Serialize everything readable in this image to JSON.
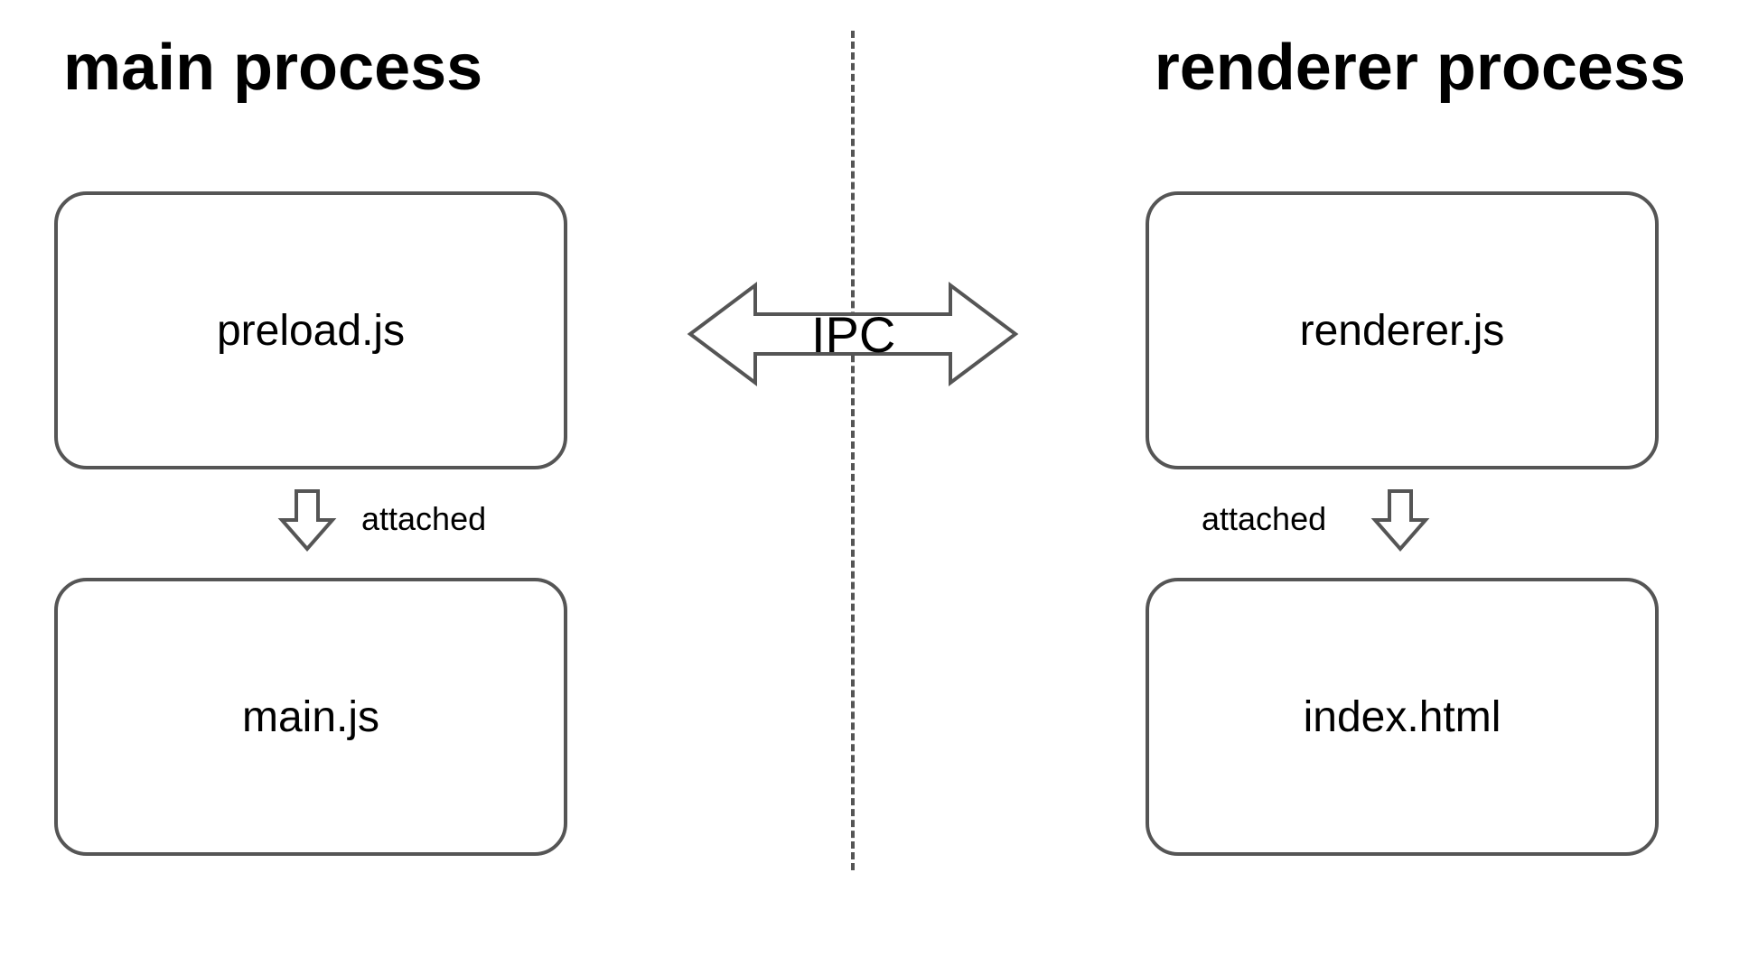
{
  "diagram": {
    "left": {
      "heading": "main process",
      "topBox": "preload.js",
      "bottomBox": "main.js",
      "arrowLabel": "attached"
    },
    "right": {
      "heading": "renderer process",
      "topBox": "renderer.js",
      "bottomBox": "index.html",
      "arrowLabel": "attached"
    },
    "center": {
      "connectorLabel": "IPC"
    }
  }
}
